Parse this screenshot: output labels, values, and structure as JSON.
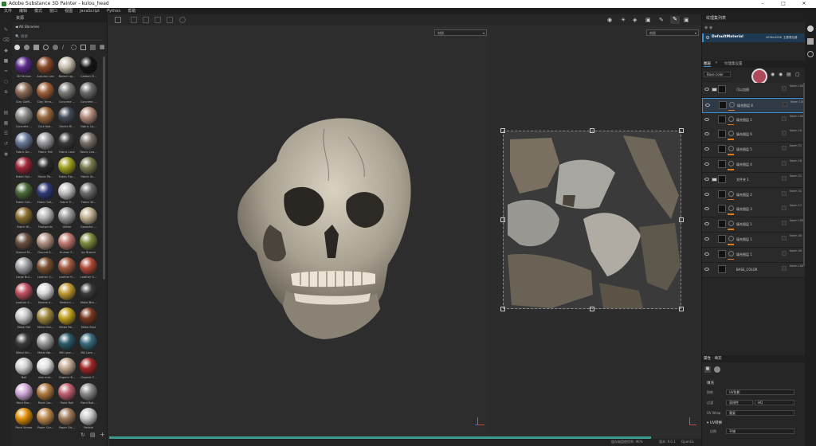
{
  "window": {
    "title": "Adobe Substance 3D Painter - kulou_head"
  },
  "menu": [
    "文件",
    "编辑",
    "模式",
    "窗口",
    "视图",
    "JavaScript",
    "Python",
    "帮助"
  ],
  "assets": {
    "title": "资源",
    "breadcrumb": "All libraries",
    "search_placeholder": "搜索",
    "materials": [
      {
        "label": "3D Sicilian",
        "color": "#5a2a8a"
      },
      {
        "label": "Autumn Lea",
        "color": "#8a4a2a"
      },
      {
        "label": "Baked Lig...",
        "color": "#c8bfae"
      },
      {
        "label": "Carbon Fi...",
        "color": "#151515"
      },
      {
        "label": "Clay Gaffi...",
        "color": "#8a6a55"
      },
      {
        "label": "Clay Terra...",
        "color": "#a0603a"
      },
      {
        "label": "Concrete ...",
        "color": "#7a7a78"
      },
      {
        "label": "Concrete ...",
        "color": "#6a6a6a"
      },
      {
        "label": "Concrete ...",
        "color": "#8a8a88"
      },
      {
        "label": "Cork Nat...",
        "color": "#9a6a40"
      },
      {
        "label": "Denim Ri...",
        "color": "#444a58"
      },
      {
        "label": "Fabric Co...",
        "color": "#b08a7a"
      },
      {
        "label": "Fabric De...",
        "color": "#6a7a9a"
      },
      {
        "label": "Fabric Felt",
        "color": "#9a9aa0"
      },
      {
        "label": "Fabric Lace",
        "color": "#3a3a3a"
      },
      {
        "label": "Fabric Lea...",
        "color": "#7a7068"
      },
      {
        "label": "Fabric Nyl...",
        "color": "#a02838"
      },
      {
        "label": "Fabric Pa...",
        "color": "#2a2a2a"
      },
      {
        "label": "Fabric Rip...",
        "color": "#a0a020"
      },
      {
        "label": "Fabric Sc...",
        "color": "#7a7a50"
      },
      {
        "label": "Fabric Sof...",
        "color": "#4a6a3a"
      },
      {
        "label": "Fabric Sof...",
        "color": "#303a78"
      },
      {
        "label": "Fabric Tr...",
        "color": "#c0c0c0"
      },
      {
        "label": "Fabric W...",
        "color": "#6a6a6a"
      },
      {
        "label": "Fabric W...",
        "color": "#8a7030"
      },
      {
        "label": "Footprints",
        "color": "#b8b8b8"
      },
      {
        "label": "Glitter",
        "color": "#9a9a9a"
      },
      {
        "label": "Gouache ...",
        "color": "#c0b090"
      },
      {
        "label": "Ground M...",
        "color": "#6a5040"
      },
      {
        "label": "Ground S...",
        "color": "#b09080"
      },
      {
        "label": "Human F...",
        "color": "#c07870"
      },
      {
        "label": "Ivy Branch",
        "color": "#7a8a3a"
      },
      {
        "label": "Large Bul...",
        "color": "#a0a0a8"
      },
      {
        "label": "Leather S...",
        "color": "#7a5030"
      },
      {
        "label": "Leather R...",
        "color": "#a05a40"
      },
      {
        "label": "Leather S...",
        "color": "#b04838"
      },
      {
        "label": "Leather S...",
        "color": "#c05060"
      },
      {
        "label": "Marble V...",
        "color": "#d8d8d8"
      },
      {
        "label": "Medium ...",
        "color": "#c09a30"
      },
      {
        "label": "Metal Bra...",
        "color": "#3a3a3a"
      },
      {
        "label": "Metal Foil",
        "color": "#c8c8c8"
      },
      {
        "label": "Metal Gol...",
        "color": "#a08a40"
      },
      {
        "label": "Metal Pol...",
        "color": "#c0a020"
      },
      {
        "label": "Metal Rust",
        "color": "#7a3a20"
      },
      {
        "label": "Metal Sm...",
        "color": "#3a3a3a"
      },
      {
        "label": "Metal We...",
        "color": "#9a9a9a"
      },
      {
        "label": "MK Lace ...",
        "color": "#2a5a6a"
      },
      {
        "label": "MK Lace ...",
        "color": "#3a6a7a"
      },
      {
        "label": "Nail",
        "color": "#d0d0d0"
      },
      {
        "label": "new mat...",
        "color": "#e0e0e0"
      },
      {
        "label": "Organic B...",
        "color": "#c0a890"
      },
      {
        "label": "Organic F...",
        "color": "#a02828"
      },
      {
        "label": "Paint Bra...",
        "color": "#d0a8d8"
      },
      {
        "label": "Paint Car...",
        "color": "#b07a40"
      },
      {
        "label": "Paint Roll",
        "color": "#c06070"
      },
      {
        "label": "Paint Roll...",
        "color": "#8a8a8a"
      },
      {
        "label": "Paint Smear",
        "color": "#e0900a"
      },
      {
        "label": "Paper Car...",
        "color": "#c08a50"
      },
      {
        "label": "Paper Dis...",
        "color": "#a07a5a"
      },
      {
        "label": "Pebble",
        "color": "#c8c8c8"
      }
    ]
  },
  "viewport": {
    "view3d_mode": "材质",
    "view2d_mode": "材质"
  },
  "texture_set_list": {
    "title": "纹理集列表",
    "material_name": "DefaultMaterial",
    "resolution": "4096x4096",
    "shader": "主要着色器"
  },
  "layers": {
    "tab_layers": "图层",
    "tab_settings": "纹理集设置",
    "channel": "Base color",
    "items": [
      {
        "name": "可以加图",
        "blend": "Norm",
        "opacity": "100",
        "type": "group"
      },
      {
        "name": "填充图层 8",
        "blend": "Norm",
        "opacity": "100",
        "type": "fill"
      },
      {
        "name": "填充图层 1",
        "blend": "Norm",
        "opacity": "100",
        "type": "fill"
      },
      {
        "name": "填充图层 6",
        "blend": "Norm",
        "opacity": "10",
        "type": "fill"
      },
      {
        "name": "填充图层 5",
        "blend": "Norm",
        "opacity": "31",
        "type": "fill"
      },
      {
        "name": "填充图层 4",
        "blend": "Norm",
        "opacity": "16",
        "type": "fill"
      },
      {
        "name": "文件夹 1",
        "blend": "Norm",
        "opacity": "31",
        "type": "folder"
      },
      {
        "name": "填充图层 2",
        "blend": "Norm",
        "opacity": "31",
        "type": "fill"
      },
      {
        "name": "填充图层 3",
        "blend": "Norm",
        "opacity": "17",
        "type": "fill"
      },
      {
        "name": "填充图层 1",
        "blend": "Norm",
        "opacity": "100",
        "type": "fill"
      },
      {
        "name": "填充图层 1",
        "blend": "Norm",
        "opacity": "40",
        "type": "fill"
      },
      {
        "name": "填充图层 1",
        "blend": "Norm",
        "opacity": "40",
        "type": "fill"
      },
      {
        "name": "BASE_COLOR",
        "blend": "Norm",
        "opacity": "100",
        "type": "fill"
      }
    ]
  },
  "properties": {
    "title": "属性 - 填充",
    "section": "填充",
    "rows": [
      {
        "label": "投射",
        "value": "UV投影"
      },
      {
        "label": "过滤",
        "value": "双线性",
        "extra": "HQ"
      },
      {
        "label": "UV Wrap",
        "value": "重复"
      }
    ],
    "uv_section": "UV转换",
    "scale_label": "比例",
    "scale_value": "平铺"
  },
  "status": {
    "text": "缓存磁盘使用率: 96%",
    "version": "版本: 9.0.1",
    "api": "OpenGL"
  }
}
